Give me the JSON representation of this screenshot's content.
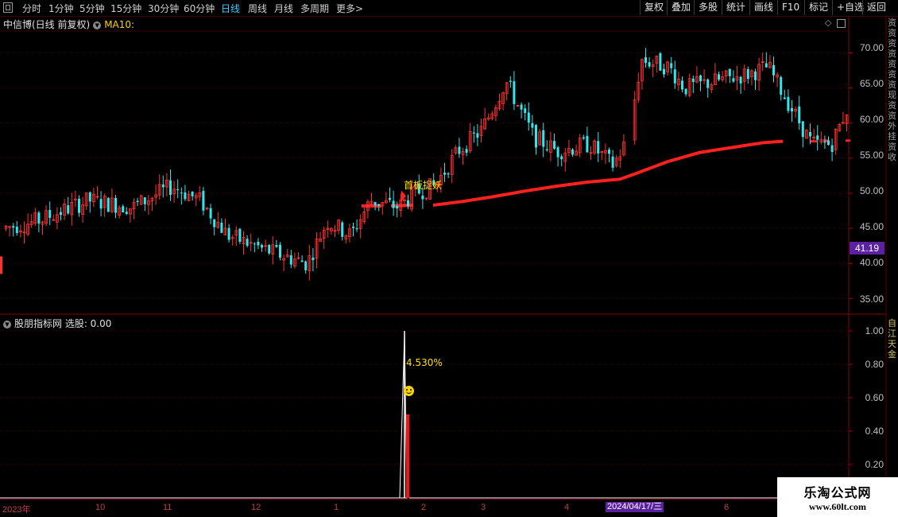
{
  "toolbar": {
    "periods": [
      "分时",
      "1分钟",
      "5分钟",
      "15分钟",
      "30分钟",
      "60分钟",
      "日线",
      "周线",
      "月线",
      "多周期",
      "更多"
    ],
    "active_period": "日线",
    "more_arrow": ">",
    "buttons": [
      "复权",
      "叠加",
      "多股",
      "统计",
      "画线",
      "F10",
      "标记",
      "+自选",
      "返回"
    ]
  },
  "main_panel": {
    "stock_title": "中信博(日线 前复权)",
    "ma_label": "MA10:",
    "signal_label": "首板捉妖",
    "current_price_tag": "41.19",
    "y_ticks": [
      "70.00",
      "65.00",
      "60.00",
      "55.00",
      "50.00",
      "45.00",
      "40.00",
      "35.00"
    ]
  },
  "indicator_panel": {
    "title": "股朋指标网  选股: 0.00",
    "pct_label": "4.530%",
    "y_ticks": [
      "1.00",
      "0.80",
      "0.60",
      "0.40",
      "0.20"
    ]
  },
  "x_axis": {
    "labels": [
      "2023年",
      "10",
      "11",
      "12",
      "1",
      "2",
      "3",
      "4",
      "2024/04/17/三",
      "6"
    ]
  },
  "side_column_text": "资资资资资资资现资资外挂资收",
  "side_column_text_2": "自江天金",
  "watermark": {
    "line1": "乐淘公式网",
    "line2": "www.60lt.com"
  },
  "colors": {
    "up": "#ff3232",
    "down": "#2ee8f0",
    "ma": "#ff2020",
    "signal": "#ffe000",
    "grid": "#5a0000"
  },
  "chart_data": {
    "type": "candlestick",
    "y_range": [
      33,
      73
    ],
    "indicator_range": [
      0,
      1
    ],
    "ma_label": "MA10",
    "signal": {
      "label": "首板捉妖",
      "value": 1.0,
      "pct": "4.530%"
    }
  }
}
